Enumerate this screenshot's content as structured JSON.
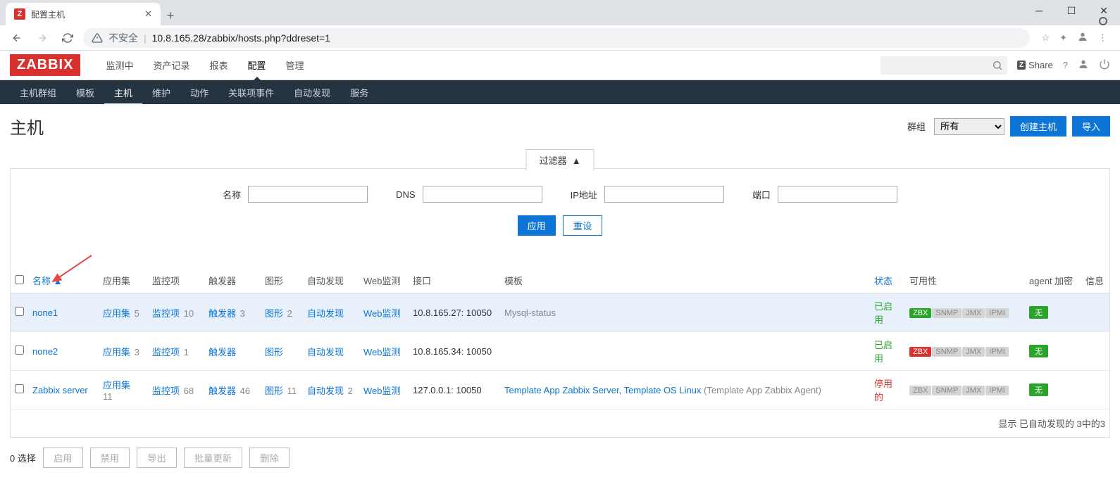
{
  "browser": {
    "tab_title": "配置主机",
    "tab_favicon_letter": "Z",
    "insecure_label": "不安全",
    "url": "10.8.165.28/zabbix/hosts.php?ddreset=1"
  },
  "header": {
    "logo": "ZABBIX",
    "nav": [
      "监测中",
      "资产记录",
      "报表",
      "配置",
      "管理"
    ],
    "nav_active_index": 3,
    "share_label": "Share"
  },
  "subnav": {
    "items": [
      "主机群组",
      "模板",
      "主机",
      "维护",
      "动作",
      "关联项事件",
      "自动发现",
      "服务"
    ],
    "active_index": 2
  },
  "page": {
    "title": "主机",
    "group_label": "群组",
    "group_selected": "所有",
    "create_host": "创建主机",
    "import": "导入"
  },
  "filter": {
    "tab_label": "过滤器",
    "name_label": "名称",
    "dns_label": "DNS",
    "ip_label": "IP地址",
    "port_label": "端口",
    "apply": "应用",
    "reset": "重设"
  },
  "table": {
    "headers": {
      "name": "名称",
      "applications": "应用集",
      "items": "监控项",
      "triggers": "触发器",
      "graphs": "图形",
      "discovery": "自动发现",
      "web": "Web监测",
      "interface": "接口",
      "templates": "模板",
      "status": "状态",
      "availability": "可用性",
      "agent_encryption": "agent 加密",
      "info": "信息"
    },
    "encryption_none": "无",
    "rows": [
      {
        "name": "none1",
        "apps": "5",
        "items": "10",
        "triggers": "3",
        "graphs": "2",
        "discovery": "",
        "web": "",
        "interface": "10.8.165.27: 10050",
        "templates": "Mysql-status",
        "templates_is_link": false,
        "status": "已启用",
        "status_type": "enabled",
        "zbx": "green",
        "highlighted": true
      },
      {
        "name": "none2",
        "apps": "3",
        "items": "1",
        "triggers": "",
        "graphs": "",
        "discovery": "",
        "web": "",
        "interface": "10.8.165.34: 10050",
        "templates": "",
        "templates_is_link": false,
        "status": "已启用",
        "status_type": "enabled",
        "zbx": "red",
        "highlighted": false
      },
      {
        "name": "Zabbix server",
        "apps": "11",
        "items": "68",
        "triggers": "46",
        "graphs": "11",
        "discovery": "2",
        "web": "",
        "interface": "127.0.0.1: 10050",
        "templates_pre": "Template App Zabbix Server, Template OS Linux",
        "templates_paren": "Template App Zabbix Agent",
        "templates_is_link": true,
        "status": "停用的",
        "status_type": "disabled",
        "zbx": "grey",
        "highlighted": false
      }
    ],
    "footer": "显示 已自动发现的 3中的3"
  },
  "bulk": {
    "selected_label": "0 选择",
    "enable": "启用",
    "disable": "禁用",
    "export": "导出",
    "mass_update": "批量更新",
    "delete": "删除"
  },
  "labels": {
    "applications": "应用集",
    "items": "监控项",
    "triggers": "触发器",
    "graphs": "图形",
    "discovery": "自动发现",
    "web": "Web监测"
  },
  "availability_labels": [
    "ZBX",
    "SNMP",
    "JMX",
    "IPMI"
  ]
}
